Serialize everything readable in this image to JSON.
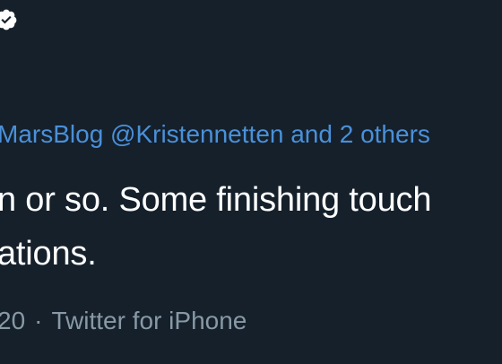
{
  "tweet": {
    "verified_icon": "verified-badge-icon",
    "reply_to": "MarsBlog @Kristennetten and 2 others",
    "text_lines": [
      "n or so. Some finishing touch",
      "ations."
    ],
    "timestamp_fragment": "20",
    "separator": "·",
    "source": "Twitter for iPhone"
  },
  "colors": {
    "background": "#15202b",
    "link": "#4a90d9",
    "text": "#ffffff",
    "muted": "#8899a6"
  }
}
